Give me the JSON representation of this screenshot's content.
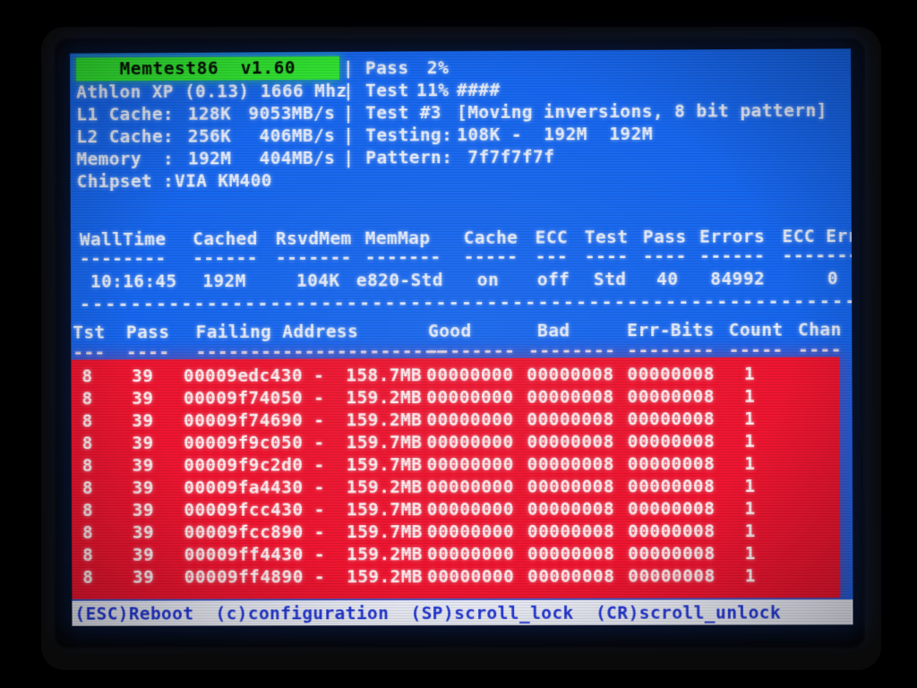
{
  "app": {
    "title": "Memtest86  v1.60",
    "banner_color": "#32e832",
    "screen_bg": "#1767ef",
    "error_bg": "#ee1530",
    "text_color": "#e9eefb",
    "status_bg": "#eef0fa",
    "status_fg": "#2438d8"
  },
  "system": {
    "cpu_line": "Athlon XP (0.13) 1666 Mhz",
    "rows": [
      {
        "label": "L1 Cache:",
        "size": "128K",
        "speed": "9053MB/s"
      },
      {
        "label": "L2 Cache:",
        "size": "256K",
        "speed": "406MB/s"
      },
      {
        "label": "Memory  :",
        "size": "192M",
        "speed": "404MB/s"
      }
    ],
    "chipset_label": "Chipset :",
    "chipset_value": "VIA KM400"
  },
  "progress": {
    "pass_label": "Pass",
    "pass_percent": "2%",
    "test_label": "Test",
    "test_percent": "11%",
    "test_bar": "####",
    "test_number_label": "Test #3",
    "test_name": "[Moving inversions, 8 bit pattern]",
    "testing_label": "Testing:",
    "testing_range": "108K -  192M  192M",
    "pattern_label": "Pattern:",
    "pattern_value": "7f7f7f7f",
    "divider_char": "|"
  },
  "status_table": {
    "headers": [
      "WallTime",
      "Cached",
      "RsvdMem",
      "MemMap",
      "Cache",
      "ECC",
      "Test",
      "Pass",
      "Errors",
      "ECC Errs"
    ],
    "underlines": [
      "--------",
      "------",
      "-------",
      "-------",
      "-----",
      "---",
      "----",
      "----",
      "------",
      "--------"
    ],
    "values": [
      "10:16:45",
      "192M",
      "104K",
      "e820-Std",
      "on",
      "off",
      "Std",
      "40",
      "84992",
      "0"
    ]
  },
  "error_table": {
    "headers": [
      "Tst",
      "Pass",
      "Failing Address",
      "Good",
      "Bad",
      "Err-Bits",
      "Count",
      "Chan"
    ],
    "underlines": [
      "---",
      "----",
      "-----------------------",
      "--------",
      "--------",
      "--------",
      "-----",
      "----"
    ],
    "rows": [
      {
        "tst": "8",
        "pass": "39",
        "address": "00009edc430 -",
        "mb": "158.7MB",
        "good": "00000000",
        "bad": "00000008",
        "err_bits": "00000008",
        "count": "1",
        "chan": ""
      },
      {
        "tst": "8",
        "pass": "39",
        "address": "00009f74050 -",
        "mb": "159.2MB",
        "good": "00000000",
        "bad": "00000008",
        "err_bits": "00000008",
        "count": "1",
        "chan": ""
      },
      {
        "tst": "8",
        "pass": "39",
        "address": "00009f74690 -",
        "mb": "159.2MB",
        "good": "00000000",
        "bad": "00000008",
        "err_bits": "00000008",
        "count": "1",
        "chan": ""
      },
      {
        "tst": "8",
        "pass": "39",
        "address": "00009f9c050 -",
        "mb": "159.7MB",
        "good": "00000000",
        "bad": "00000008",
        "err_bits": "00000008",
        "count": "1",
        "chan": ""
      },
      {
        "tst": "8",
        "pass": "39",
        "address": "00009f9c2d0 -",
        "mb": "159.7MB",
        "good": "00000000",
        "bad": "00000008",
        "err_bits": "00000008",
        "count": "1",
        "chan": ""
      },
      {
        "tst": "8",
        "pass": "39",
        "address": "00009fa4430 -",
        "mb": "159.2MB",
        "good": "00000000",
        "bad": "00000008",
        "err_bits": "00000008",
        "count": "1",
        "chan": ""
      },
      {
        "tst": "8",
        "pass": "39",
        "address": "00009fcc430 -",
        "mb": "159.7MB",
        "good": "00000000",
        "bad": "00000008",
        "err_bits": "00000008",
        "count": "1",
        "chan": ""
      },
      {
        "tst": "8",
        "pass": "39",
        "address": "00009fcc890 -",
        "mb": "159.7MB",
        "good": "00000000",
        "bad": "00000008",
        "err_bits": "00000008",
        "count": "1",
        "chan": ""
      },
      {
        "tst": "8",
        "pass": "39",
        "address": "00009ff4430 -",
        "mb": "159.2MB",
        "good": "00000000",
        "bad": "00000008",
        "err_bits": "00000008",
        "count": "1",
        "chan": ""
      },
      {
        "tst": "8",
        "pass": "39",
        "address": "00009ff4890 -",
        "mb": "159.2MB",
        "good": "00000000",
        "bad": "00000008",
        "err_bits": "00000008",
        "count": "1",
        "chan": ""
      }
    ]
  },
  "separator": "-------------------------------------------------------------------",
  "statusbar": {
    "items": [
      "(ESC)Reboot",
      "(c)configuration",
      "(SP)scroll_lock",
      "(CR)scroll_unlock"
    ],
    "text": "(ESC)Reboot  (c)configuration  (SP)scroll_lock  (CR)scroll_unlock"
  }
}
